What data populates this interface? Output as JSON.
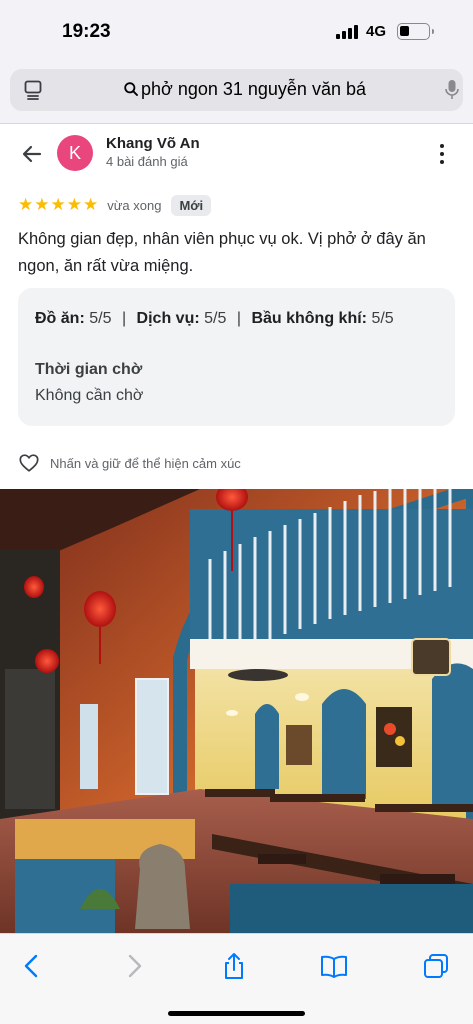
{
  "status_bar": {
    "time": "19:23",
    "network": "4G"
  },
  "url_bar": {
    "query": "phở ngon 31 nguyễn văn bá"
  },
  "reviewer": {
    "initial": "K",
    "name": "Khang Võ An",
    "review_count": "4 bài đánh giá",
    "avatar_color": "#e8467c"
  },
  "review": {
    "stars": "★★★★★",
    "rating": 5,
    "time": "vừa xong",
    "badge": "Mới",
    "text": "Không gian đẹp, nhân viên phục vụ ok. Vị phở ở đây ăn ngon, ăn rất vừa miệng.",
    "ratings": [
      {
        "label": "Đồ ăn:",
        "value": "5/5"
      },
      {
        "label": "Dịch vụ:",
        "value": "5/5"
      },
      {
        "label": "Bầu không khí:",
        "value": "5/5"
      }
    ],
    "wait_label": "Thời gian chờ",
    "wait_value": "Không cần chờ",
    "react_hint": "Nhấn và giữ để thể hiện cảm xúc"
  },
  "colors": {
    "star": "#fbbc04",
    "accent": "#007aff"
  }
}
